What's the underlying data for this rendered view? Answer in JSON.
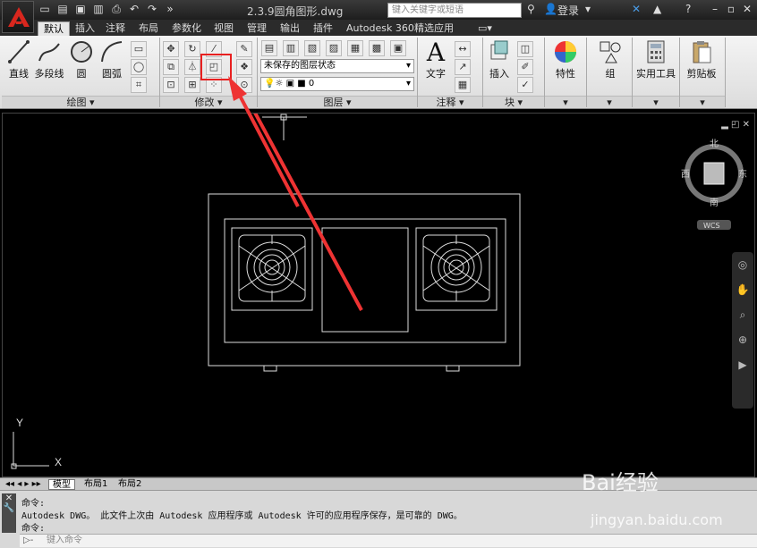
{
  "title_bar": {
    "doc_title": "2.3.9圆角图形.dwg",
    "search_placeholder": "键入关键字或短语",
    "login_label": "登录"
  },
  "ribbon_tabs": [
    "默认",
    "插入",
    "注释",
    "布局",
    "参数化",
    "视图",
    "管理",
    "输出",
    "插件",
    "Autodesk 360",
    "精选应用"
  ],
  "draw_panel": {
    "title": "绘图",
    "line": "直线",
    "polyline": "多段线",
    "circle": "圆",
    "arc": "圆弧"
  },
  "modify_panel": {
    "title": "修改"
  },
  "layer_panel": {
    "title": "图层",
    "layer_state": "未保存的图层状态",
    "current_layer": "0"
  },
  "annotation_panel": {
    "title": "注释",
    "text": "文字"
  },
  "block_panel": {
    "title": "块",
    "insert": "插入"
  },
  "properties_label": "特性",
  "group_label": "组",
  "utilities_label": "实用工具",
  "clipboard_label": "剪贴板",
  "viewcube": {
    "north": "北",
    "south": "南",
    "east": "东",
    "west": "西",
    "wcs": "WCS"
  },
  "ucs": {
    "x": "X",
    "y": "Y"
  },
  "layout_tabs": [
    "模型",
    "布局1",
    "布局2"
  ],
  "command": {
    "line1": "命令:",
    "line2": "Autodesk DWG。  此文件上次由 Autodesk 应用程序或 Autodesk 许可的应用程序保存，是可靠的 DWG。",
    "line3": "命令:",
    "input_placeholder": "键入命令"
  },
  "watermark": {
    "brand": "Bai经验",
    "url": "jingyan.baidu.com"
  },
  "colors": {
    "highlight": "#e82020",
    "arrow": "#ee3333",
    "canvas": "#000000"
  }
}
